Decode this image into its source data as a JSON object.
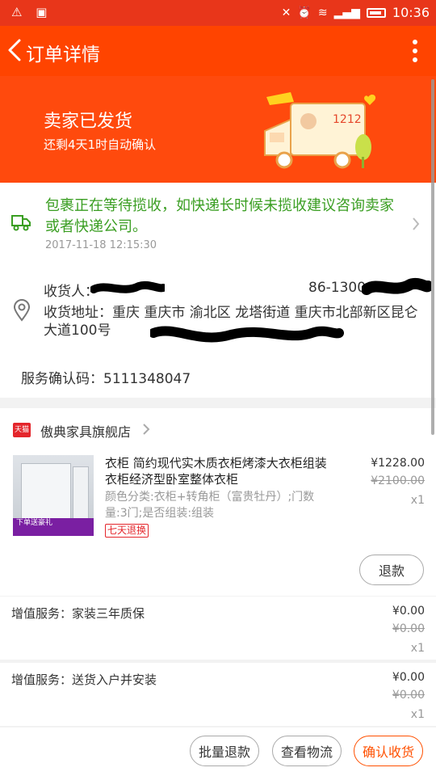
{
  "status_bar": {
    "time": "10:36"
  },
  "topbar": {
    "title": "订单详情"
  },
  "banner": {
    "status": "卖家已发货",
    "subtitle": "还剩4天1时自动确认"
  },
  "logistics": {
    "message": "包裹正在等待揽收，如快递长时候未揽收建议咨询卖家或者快递公司。",
    "time": "2017-11-18 12:15:30"
  },
  "address": {
    "recipient_label": "收货人：",
    "phone": "86-13008",
    "address_text": "收货地址：重庆 重庆市 渝北区 龙塔街道 重庆市北部新区昆仑大道100号"
  },
  "service_code": "服务确认码：5111348047",
  "store": {
    "badge": "天猫",
    "name": "傲典家具旗舰店"
  },
  "product": {
    "title": "衣柜 简约现代实木质衣柜烤漆大衣柜组装衣柜经济型卧室整体衣柜",
    "attributes": "颜色分类:衣柜+转角柜（富贵牡丹）;门数量:3门;是否组装:组装",
    "tag": "七天退换",
    "thumb_promo": "下单送豪礼",
    "price": "¥1228.00",
    "original_price": "¥2100.00",
    "quantity": "x1",
    "refund_label": "退款"
  },
  "value_added": [
    {
      "label": "增值服务：家装三年质保",
      "price": "¥0.00",
      "original_price": "¥0.00",
      "quantity": "x1"
    },
    {
      "label": "增值服务：送货入户并安装",
      "price": "¥0.00",
      "original_price": "¥0.00",
      "quantity": "x1"
    }
  ],
  "footer": {
    "batch_refund": "批量退款",
    "view_logistics": "查看物流",
    "confirm_receipt": "确认收货"
  },
  "colors": {
    "header": "#ff4400",
    "tracking_green": "#3a9e22",
    "tmall_red": "#e4252b",
    "confirm_orange": "#ff5000"
  }
}
